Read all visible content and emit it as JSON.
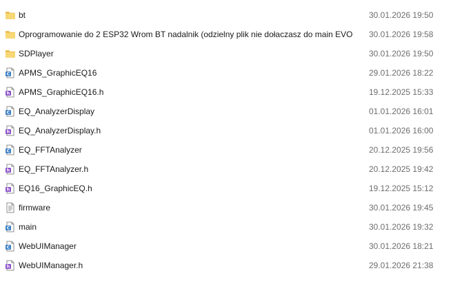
{
  "files": [
    {
      "name": "bt",
      "modified": "30.01.2026 19:50",
      "type": "folder",
      "icon": "folder-icon"
    },
    {
      "name": "Oprogramowanie do 2 ESP32 Wrom BT nadalnik (odzielny plik nie dołaczasz do main EVO",
      "modified": "30.01.2026 19:58",
      "type": "folder",
      "icon": "folder-icon"
    },
    {
      "name": "SDPlayer",
      "modified": "30.01.2026 19:50",
      "type": "folder",
      "icon": "folder-icon"
    },
    {
      "name": "APMS_GraphicEQ16",
      "modified": "29.01.2026 18:22",
      "type": "c-source",
      "icon": "c-source-file-icon"
    },
    {
      "name": "APMS_GraphicEQ16.h",
      "modified": "19.12.2025 15:33",
      "type": "header",
      "icon": "header-file-icon"
    },
    {
      "name": "EQ_AnalyzerDisplay",
      "modified": "01.01.2026 16:01",
      "type": "c-source",
      "icon": "c-source-file-icon"
    },
    {
      "name": "EQ_AnalyzerDisplay.h",
      "modified": "01.01.2026 16:00",
      "type": "header",
      "icon": "header-file-icon"
    },
    {
      "name": "EQ_FFTAnalyzer",
      "modified": "20.12.2025 19:56",
      "type": "c-source",
      "icon": "c-source-file-icon"
    },
    {
      "name": "EQ_FFTAnalyzer.h",
      "modified": "20.12.2025 19:42",
      "type": "header",
      "icon": "header-file-icon"
    },
    {
      "name": "EQ16_GraphicEQ.h",
      "modified": "19.12.2025 15:12",
      "type": "header",
      "icon": "header-file-icon"
    },
    {
      "name": "firmware",
      "modified": "30.01.2026 19:45",
      "type": "text",
      "icon": "text-file-icon"
    },
    {
      "name": "main",
      "modified": "30.01.2026 19:32",
      "type": "c-source",
      "icon": "c-source-file-icon"
    },
    {
      "name": "WebUIManager",
      "modified": "30.01.2026 18:21",
      "type": "c-source",
      "icon": "c-source-file-icon"
    },
    {
      "name": "WebUIManager.h",
      "modified": "29.01.2026 21:38",
      "type": "header",
      "icon": "header-file-icon"
    }
  ],
  "colors": {
    "folder": "#f8d775",
    "folder_dark": "#e6b43c",
    "source_accent": "#3a7fc4",
    "header_accent": "#8a4fc8",
    "date_text": "#6d6d6d"
  }
}
